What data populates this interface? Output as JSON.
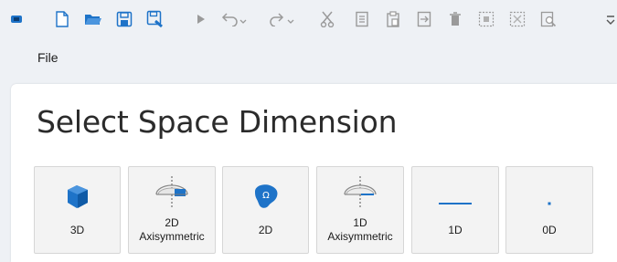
{
  "menu": {
    "file_label": "File"
  },
  "panel": {
    "title": "Select Space Dimension"
  },
  "dimensions": [
    {
      "line1": "3D",
      "line2": ""
    },
    {
      "line1": "2D",
      "line2": "Axisymmetric"
    },
    {
      "line1": "2D",
      "line2": ""
    },
    {
      "line1": "1D",
      "line2": "Axisymmetric"
    },
    {
      "line1": "1D",
      "line2": ""
    },
    {
      "line1": "0D",
      "line2": ""
    }
  ],
  "colors": {
    "accent_blue": "#1e73c8",
    "toolbar_gray": "#8a8a8a"
  }
}
